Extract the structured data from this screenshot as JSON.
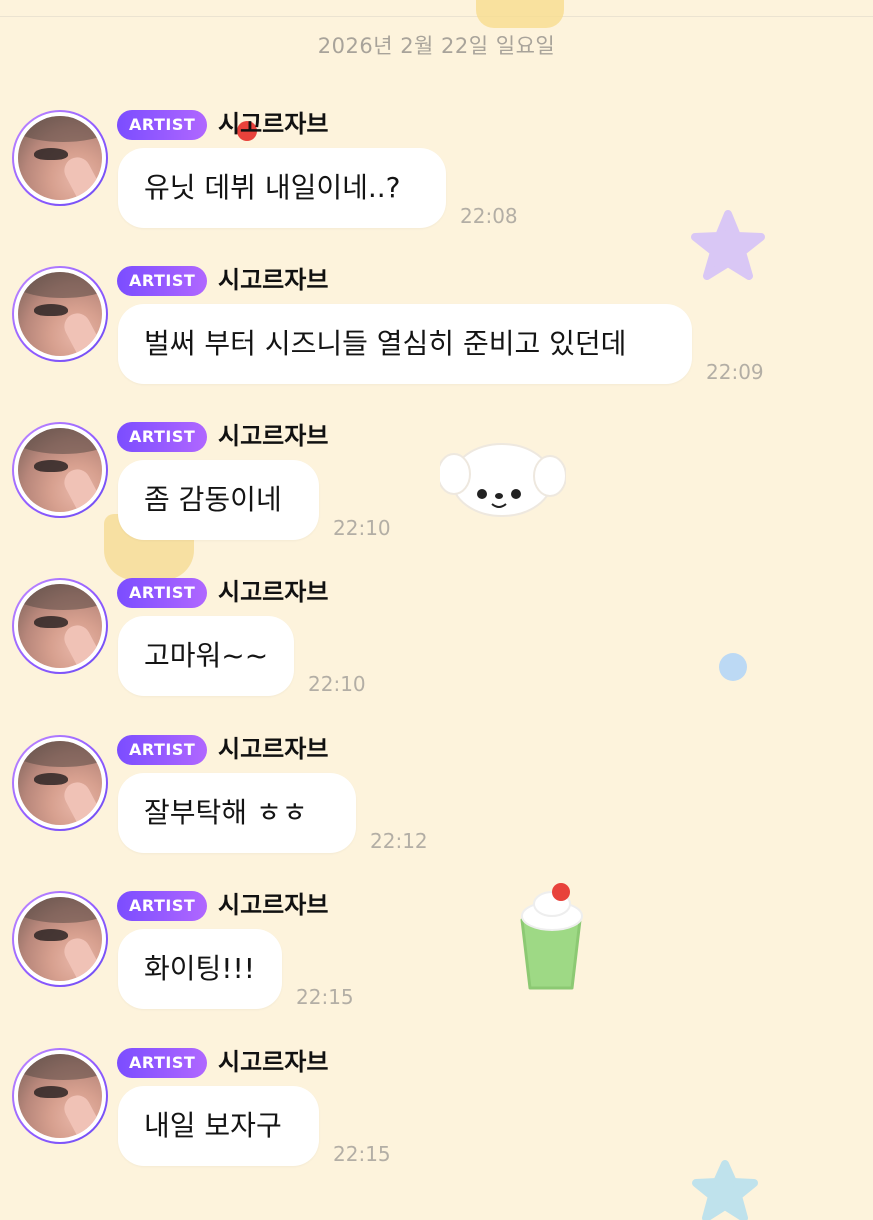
{
  "date_separator": "2026년 2월 22일 일요일",
  "badge_label": "ARTIST",
  "sender_name": "시고르자브",
  "messages": [
    {
      "text": "유닛 데뷔 내일이네..?",
      "time": "22:08"
    },
    {
      "text": "벌써 부터 시즈니들 열심히 준비고 있던데",
      "time": "22:09"
    },
    {
      "text": "좀 감동이네",
      "time": "22:10"
    },
    {
      "text": "고마워~~",
      "time": "22:10"
    },
    {
      "text": "잘부탁해 ㅎㅎ",
      "time": "22:12"
    },
    {
      "text": "화이팅!!!",
      "time": "22:15"
    },
    {
      "text": "내일 보자구",
      "time": "22:15"
    }
  ],
  "colors": {
    "background": "#fdf3dc",
    "badge_gradient_start": "#7b4dff",
    "badge_gradient_end": "#b067ff",
    "bubble": "#ffffff",
    "timestamp": "#b3aea5"
  }
}
